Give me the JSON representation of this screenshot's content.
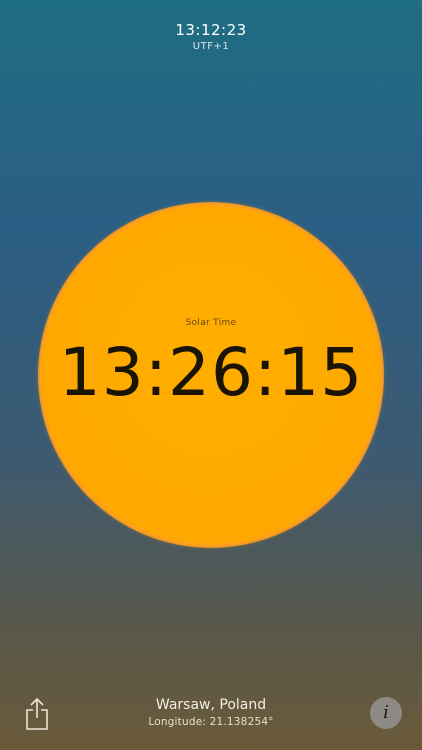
{
  "header": {
    "local_time": "13:12:23",
    "timezone": "UTF+1"
  },
  "sun": {
    "label": "Solar Time",
    "solar_time": "13:26:15",
    "color": "#ffa800"
  },
  "footer": {
    "city": "Warsaw, Poland",
    "longitude": "Longitude: 21.138254°",
    "share_icon": "share-icon",
    "info_icon": "info-icon",
    "info_glyph": "i"
  }
}
